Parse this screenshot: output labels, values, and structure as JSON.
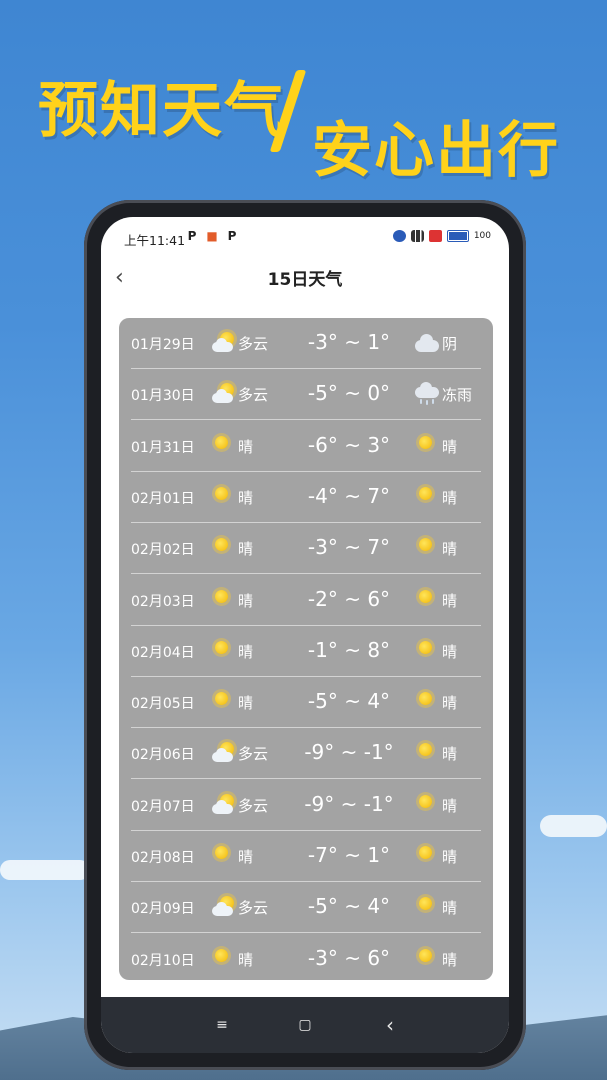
{
  "headline": {
    "line1": "预知天气",
    "line2": "安心出行"
  },
  "status_bar": {
    "time": "上午11:41",
    "app_icons": [
      "P",
      "■",
      "P"
    ],
    "battery": "100"
  },
  "page": {
    "back": "‹",
    "title": "15日天气"
  },
  "forecast": [
    {
      "date": "01月29日",
      "day_icon": "partly-cloudy",
      "day": "多云",
      "temp": "-3° ~ 1°",
      "night_icon": "overcast",
      "night": "阴"
    },
    {
      "date": "01月30日",
      "day_icon": "partly-cloudy",
      "day": "多云",
      "temp": "-5° ~ 0°",
      "night_icon": "freezing-rain",
      "night": "冻雨"
    },
    {
      "date": "01月31日",
      "day_icon": "sunny",
      "day": "晴",
      "temp": "-6° ~ 3°",
      "night_icon": "sunny",
      "night": "晴"
    },
    {
      "date": "02月01日",
      "day_icon": "sunny",
      "day": "晴",
      "temp": "-4° ~ 7°",
      "night_icon": "sunny",
      "night": "晴"
    },
    {
      "date": "02月02日",
      "day_icon": "sunny",
      "day": "晴",
      "temp": "-3° ~ 7°",
      "night_icon": "sunny",
      "night": "晴"
    },
    {
      "date": "02月03日",
      "day_icon": "sunny",
      "day": "晴",
      "temp": "-2° ~ 6°",
      "night_icon": "sunny",
      "night": "晴"
    },
    {
      "date": "02月04日",
      "day_icon": "sunny",
      "day": "晴",
      "temp": "-1° ~ 8°",
      "night_icon": "sunny",
      "night": "晴"
    },
    {
      "date": "02月05日",
      "day_icon": "sunny",
      "day": "晴",
      "temp": "-5° ~ 4°",
      "night_icon": "sunny",
      "night": "晴"
    },
    {
      "date": "02月06日",
      "day_icon": "partly-cloudy",
      "day": "多云",
      "temp": "-9° ~ -1°",
      "night_icon": "sunny",
      "night": "晴"
    },
    {
      "date": "02月07日",
      "day_icon": "partly-cloudy",
      "day": "多云",
      "temp": "-9° ~ -1°",
      "night_icon": "sunny",
      "night": "晴"
    },
    {
      "date": "02月08日",
      "day_icon": "sunny",
      "day": "晴",
      "temp": "-7° ~ 1°",
      "night_icon": "sunny",
      "night": "晴"
    },
    {
      "date": "02月09日",
      "day_icon": "partly-cloudy",
      "day": "多云",
      "temp": "-5° ~ 4°",
      "night_icon": "sunny",
      "night": "晴"
    },
    {
      "date": "02月10日",
      "day_icon": "sunny",
      "day": "晴",
      "temp": "-3° ~ 6°",
      "night_icon": "sunny",
      "night": "晴"
    }
  ],
  "nav": {
    "menu": "≡",
    "home": "▢",
    "back": "‹"
  },
  "colors": {
    "headline": "#ffd21a",
    "card": "#a3a3a3",
    "navbar": "#2b2f36"
  }
}
